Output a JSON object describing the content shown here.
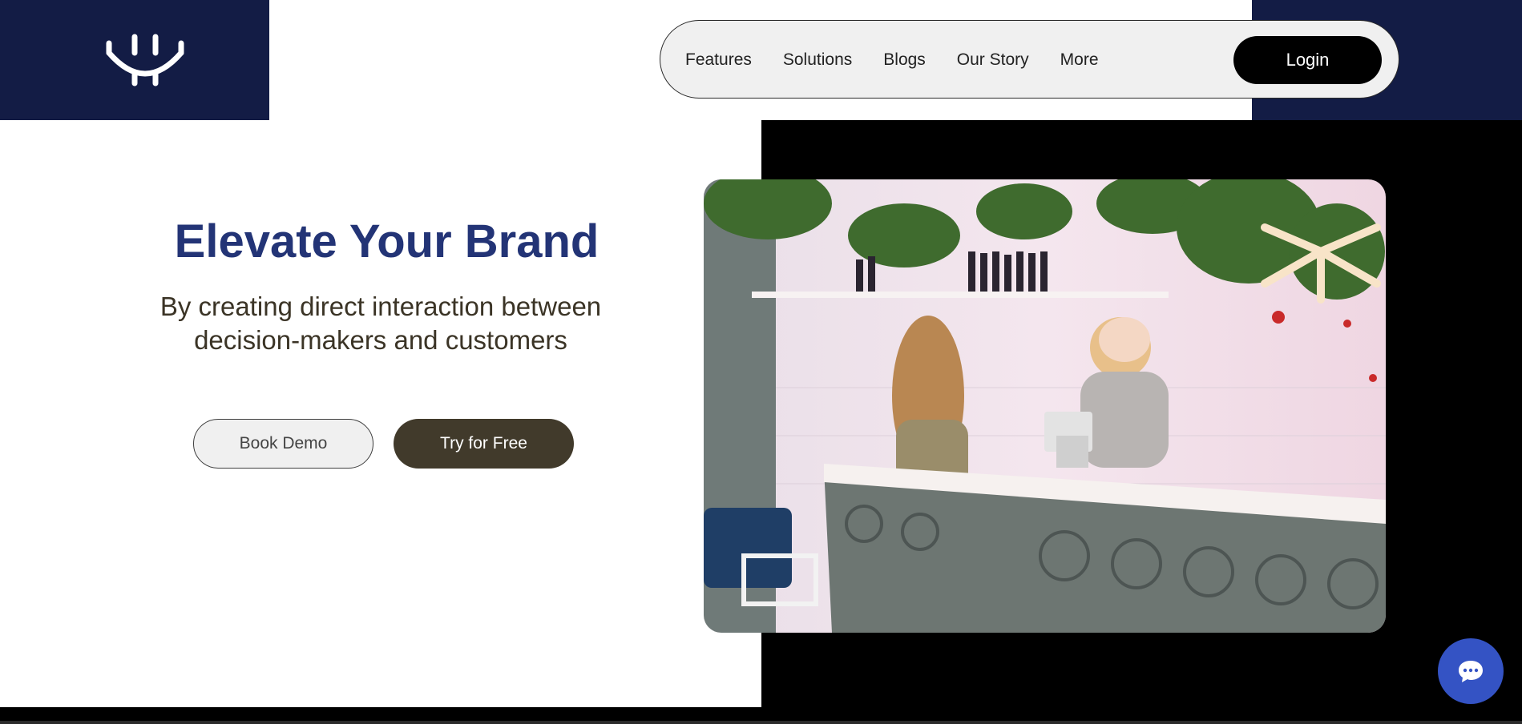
{
  "nav": {
    "items": [
      {
        "label": "Features"
      },
      {
        "label": "Solutions"
      },
      {
        "label": "Blogs"
      },
      {
        "label": "Our Story"
      },
      {
        "label": "More"
      }
    ],
    "login_label": "Login"
  },
  "hero": {
    "title": "Elevate Your Brand",
    "subtitle": "By creating direct interaction between decision-makers and customers",
    "book_demo_label": "Book Demo",
    "try_free_label": "Try for Free"
  },
  "icons": {
    "logo": "smile-logo-icon",
    "chat": "chat-bubble-icon"
  },
  "colors": {
    "navy": "#131c45",
    "title_blue": "#233476",
    "dark_brown": "#413a2b",
    "chat_blue": "#3453c4"
  }
}
